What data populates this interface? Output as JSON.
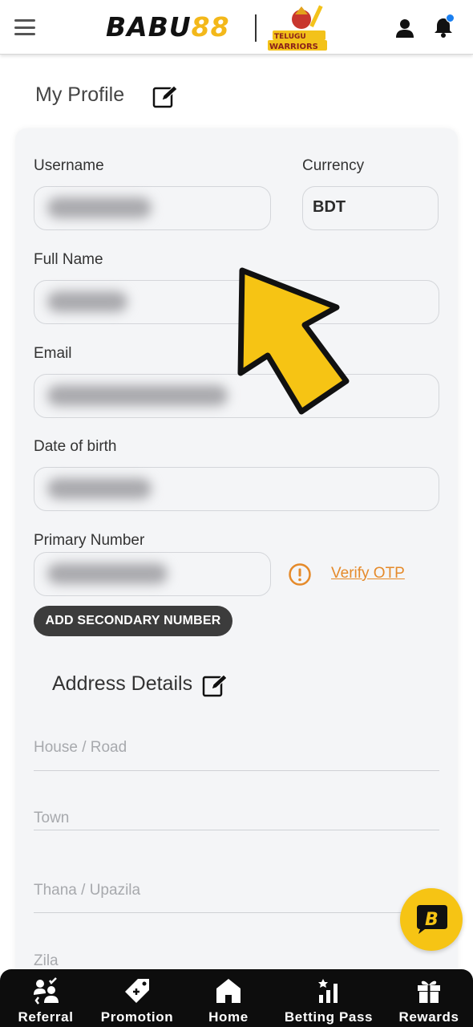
{
  "header": {
    "logo_text_main": "BABU",
    "logo_text_accent": "88",
    "partner_logo_text": "TELUGU WARRIORS"
  },
  "profile": {
    "title": "My Profile",
    "fields": {
      "username_label": "Username",
      "currency_label": "Currency",
      "currency_value": "BDT",
      "full_name_label": "Full Name",
      "email_label": "Email",
      "dob_label": "Date of birth",
      "primary_number_label": "Primary Number",
      "verify_link": "Verify OTP",
      "secondary_button": "ADD SECONDARY NUMBER"
    }
  },
  "address": {
    "title": "Address Details",
    "house_placeholder": "House / Road",
    "town_placeholder": "Town",
    "thana_placeholder": "Thana / Upazila",
    "zila_placeholder": "Zila"
  },
  "bottom_nav": {
    "items": [
      {
        "label": "Referral",
        "icon": "referral-icon"
      },
      {
        "label": "Promotion",
        "icon": "promotion-icon"
      },
      {
        "label": "Home",
        "icon": "home-icon"
      },
      {
        "label": "Betting Pass",
        "icon": "betting-pass-icon"
      },
      {
        "label": "Rewards",
        "icon": "rewards-icon"
      }
    ]
  },
  "colors": {
    "brand_yellow": "#f3b81a",
    "link_orange": "#e58a2a",
    "notification_blue": "#1a7ff0",
    "nav_background": "#0d0d0d"
  }
}
